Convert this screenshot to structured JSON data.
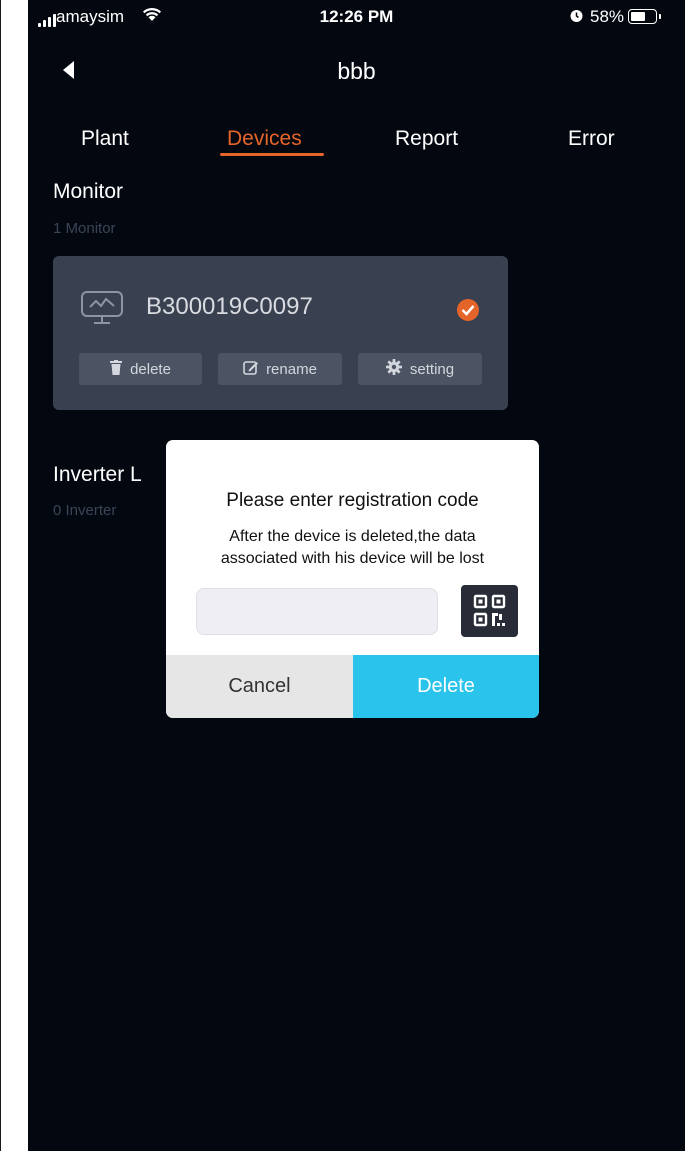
{
  "status_bar": {
    "carrier": "amaysim",
    "time": "12:26 PM",
    "battery_percent": "58%"
  },
  "header": {
    "title": "bbb"
  },
  "tabs": [
    {
      "label": "Plant",
      "active": false
    },
    {
      "label": "Devices",
      "active": true
    },
    {
      "label": "Report",
      "active": false
    },
    {
      "label": "Error",
      "active": false
    }
  ],
  "monitor_section": {
    "title": "Monitor",
    "count": "1 Monitor",
    "device": {
      "serial": "B300019C0097",
      "actions": {
        "delete": "delete",
        "rename": "rename",
        "setting": "setting"
      }
    }
  },
  "inverter_section": {
    "title": "Inverter L",
    "count": "0 Inverter"
  },
  "dialog": {
    "title": "Please enter registration code",
    "message_line1": "After the device is deleted,the data",
    "message_line2": "associated with his device will be lost",
    "input_value": "",
    "cancel_label": "Cancel",
    "delete_label": "Delete"
  },
  "colors": {
    "background": "#03070f",
    "accent": "#e5642a",
    "card": "#394150",
    "delete_button": "#29c3ec"
  },
  "icons": [
    "signal-icon",
    "wifi-icon",
    "alarm-icon",
    "battery-icon",
    "back-arrow-icon",
    "monitor-icon",
    "check-circle-icon",
    "trash-icon",
    "edit-icon",
    "gear-icon",
    "qr-code-icon"
  ]
}
